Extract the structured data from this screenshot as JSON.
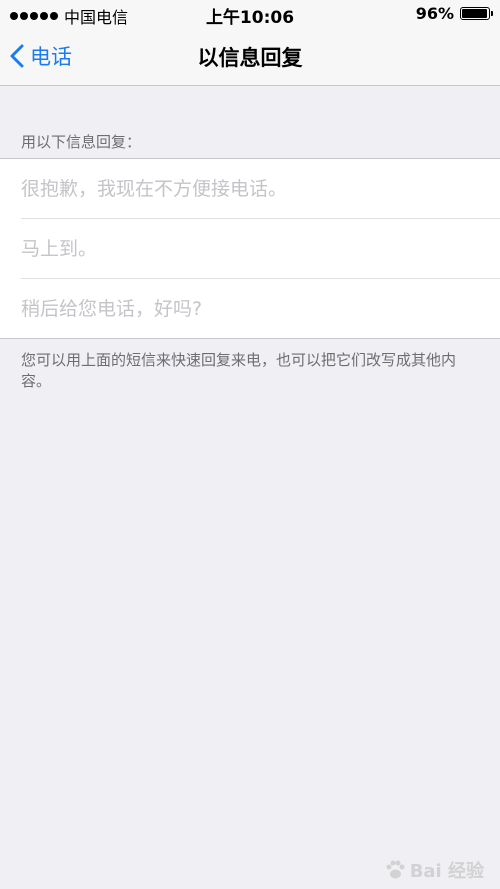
{
  "status_bar": {
    "carrier": "中国电信",
    "time": "上午10:06",
    "battery": "96%",
    "battery_level": 0.96
  },
  "nav": {
    "back_label": "电话",
    "title": "以信息回复"
  },
  "section_header": "用以下信息回复：",
  "responses": [
    {
      "value": "",
      "placeholder": "很抱歉，我现在不方便接电话。"
    },
    {
      "value": "",
      "placeholder": "马上到。"
    },
    {
      "value": "",
      "placeholder": "稍后给您电话，好吗?"
    }
  ],
  "footer_note": "您可以用上面的短信来快速回复来电，也可以把它们改写成其他内容。",
  "watermark": "Bai 经验",
  "colors": {
    "accent": "#1a7cf0",
    "background": "#efeff4"
  }
}
